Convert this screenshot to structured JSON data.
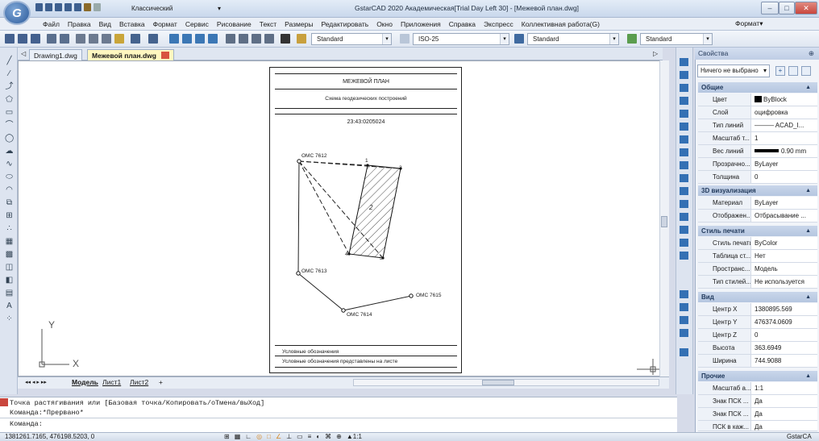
{
  "app": {
    "logo": "G",
    "title": "GstarCAD 2020 Академическая[Trial Day Left 30] - [Межевой план.dwg]",
    "workspace": "Классический",
    "window_min": "–",
    "window_max": "□",
    "window_close": "✕"
  },
  "menu": {
    "items": [
      "Файл",
      "Правка",
      "Вид",
      "Вставка",
      "Формат",
      "Сервис",
      "Рисование",
      "Текст",
      "Размеры",
      "Редактировать",
      "Окно",
      "Приложения",
      "Справка",
      "Экспресс",
      "Коллективная работа(G)"
    ],
    "right_label": "Формат▾"
  },
  "toolbar": {
    "text_style": "Standard",
    "dim_style": "ISO-25",
    "table_style": "Standard",
    "multileader_style": "Standard"
  },
  "tabs": {
    "items": [
      "Drawing1.dwg",
      "Межевой план.dwg"
    ],
    "active": 1
  },
  "drawing": {
    "header": "МЕЖЕВОЙ ПЛАН",
    "subheader": "Схема геодезических построений",
    "cadastral": "23:43:0205024",
    "points": {
      "omc7612": "ОМС 7612",
      "omc7613": "ОМС 7613",
      "omc7614": "ОМС 7614",
      "omc7615": "ОМС 7615"
    },
    "vertices": {
      "v1": "1",
      "v2": "2",
      "v3": "3",
      "v4": "4"
    },
    "parcel": "2",
    "legend_title": "Условные обозначения",
    "legend_text": "Условные обозначения представлены на листе",
    "ucs_y": "Y",
    "ucs_x": "X"
  },
  "layout_tabs": [
    "Модель",
    "Лист1",
    "Лист2",
    "+"
  ],
  "command": {
    "line1": "Точка растягивания или [Базовая точка/Копировать/оТмена/выХод]",
    "line2": "Команда:*Прервано*",
    "prompt": "Команда:"
  },
  "status": {
    "coords": "1381261.7165, 476198.5203, 0",
    "scale": "1:1",
    "right_label": "GstarCA"
  },
  "properties": {
    "title": "Свойства",
    "pin": "⊕",
    "selection": "Ничего не выбрано",
    "sections": [
      {
        "name": "Общие",
        "rows": [
          {
            "k": "Цвет",
            "v": "ByBlock"
          },
          {
            "k": "Слой",
            "v": "оцифровка"
          },
          {
            "k": "Тип линий",
            "v": "——— ACAD_I..."
          },
          {
            "k": "Масштаб т...",
            "v": "1"
          },
          {
            "k": "Вес линий",
            "v": "0.90 mm"
          },
          {
            "k": "Прозрачно...",
            "v": "ByLayer"
          },
          {
            "k": "Толщина",
            "v": "0"
          }
        ]
      },
      {
        "name": "3D визуализация",
        "rows": [
          {
            "k": "Материал",
            "v": "ByLayer"
          },
          {
            "k": "Отображен...",
            "v": "Отбрасывание ..."
          }
        ]
      },
      {
        "name": "Стиль печати",
        "rows": [
          {
            "k": "Стиль печати",
            "v": "ByColor"
          },
          {
            "k": "Таблица ст...",
            "v": "Нет"
          },
          {
            "k": "Пространс...",
            "v": "Модель"
          },
          {
            "k": "Тип стилей...",
            "v": "Не используется"
          }
        ]
      },
      {
        "name": "Вид",
        "rows": [
          {
            "k": "Центр X",
            "v": "1380895.569"
          },
          {
            "k": "Центр Y",
            "v": "476374.0609"
          },
          {
            "k": "Центр Z",
            "v": "0"
          },
          {
            "k": "Высота",
            "v": "363.6949"
          },
          {
            "k": "Ширина",
            "v": "744.9088"
          }
        ]
      },
      {
        "name": "Прочие",
        "rows": [
          {
            "k": "Масштаб а...",
            "v": "1:1"
          },
          {
            "k": "Знак ПСК ...",
            "v": "Да"
          },
          {
            "k": "Знак ПСК ...",
            "v": "Да"
          },
          {
            "k": "ПСК в каж...",
            "v": "Да"
          }
        ]
      }
    ]
  },
  "colors": {
    "accent": "#2b5a9a",
    "active_tab": "#fff7c0",
    "close_button": "#c9463d"
  }
}
